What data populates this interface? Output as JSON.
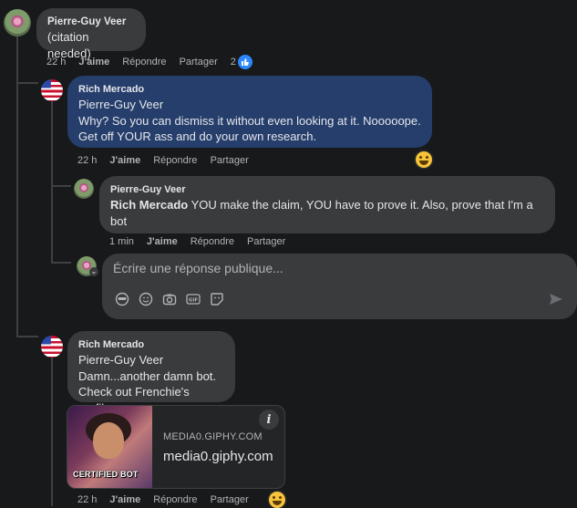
{
  "thread": {
    "comments": [
      {
        "author": "Pierre-Guy Veer",
        "text": "(citation needed)",
        "time": "22 h",
        "like": "J'aime",
        "reply": "Répondre",
        "share": "Partager",
        "reactions": "2"
      },
      {
        "author": "Rich Mercado",
        "mention": "Pierre-Guy Veer",
        "lines": [
          "Why? So you can dismiss it without even looking at it. Nooooope.",
          "Get off YOUR ass and do your own research."
        ],
        "time": "22 h",
        "like": "J'aime",
        "reply": "Répondre",
        "share": "Partager"
      },
      {
        "author": "Pierre-Guy Veer",
        "mention": "Rich Mercado",
        "text_line1": " YOU make the claim, YOU have to prove it. Also, prove that I'm a",
        "text_line2": "bot",
        "time": "1 min",
        "like": "J'aime",
        "reply": "Répondre",
        "share": "Partager"
      },
      {
        "author": "Rich Mercado",
        "mention": "Pierre-Guy Veer",
        "lines": [
          "Damn...another damn bot.",
          "Check out Frenchie's profile."
        ],
        "time": "22 h",
        "like": "J'aime",
        "reply": "Répondre",
        "share": "Partager"
      }
    ],
    "reply_box": {
      "placeholder": "Écrire une réponse publique..."
    },
    "link_preview": {
      "domain": "MEDIA0.GIPHY.COM",
      "site": "media0.giphy.com",
      "thumbnail_caption": "CERTIFIED BOT",
      "info": "i"
    }
  },
  "colors": {
    "background": "#18191a",
    "bubble": "#3a3b3c",
    "bubble_highlight": "#263e6b",
    "like_blue": "#2d88ff"
  }
}
